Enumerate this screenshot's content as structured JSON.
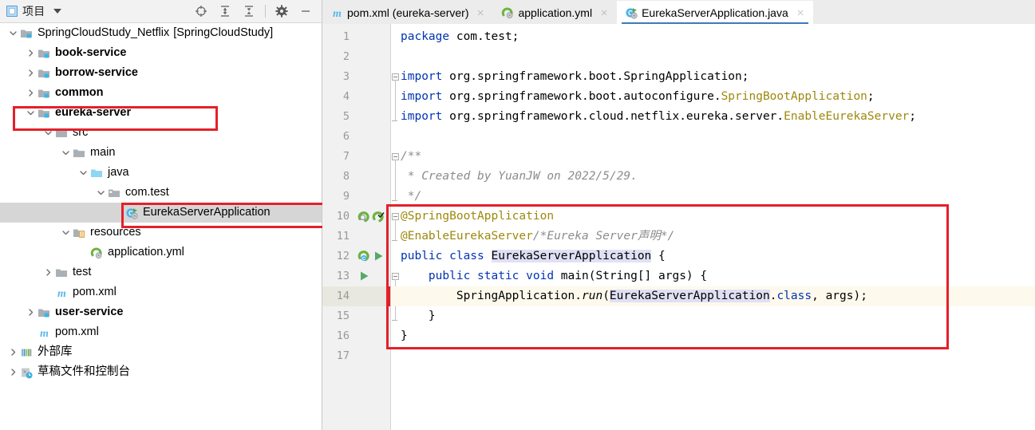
{
  "panel": {
    "title": "项目",
    "icons": [
      {
        "name": "locate-icon",
        "label": "定位"
      },
      {
        "name": "expand-all-icon",
        "label": "展开全部"
      },
      {
        "name": "collapse-all-icon",
        "label": "折叠全部"
      },
      {
        "name": "gear-icon",
        "label": "设置"
      },
      {
        "name": "minimize-icon",
        "label": "最小化"
      }
    ],
    "dropdown_label": "项目"
  },
  "tree": [
    {
      "id": "root",
      "label": "SpringCloudStudy_Netflix",
      "suffix": "[SpringCloudStudy]",
      "depth": 0,
      "arrow": "down",
      "icon": "module-folder",
      "bold": false,
      "bold_suffix": true,
      "selected": false,
      "boxed": false
    },
    {
      "id": "book-service",
      "label": "book-service",
      "depth": 1,
      "arrow": "right",
      "icon": "module-folder",
      "bold": true,
      "selected": false,
      "boxed": false
    },
    {
      "id": "borrow-service",
      "label": "borrow-service",
      "depth": 1,
      "arrow": "right",
      "icon": "module-folder",
      "bold": true,
      "selected": false,
      "boxed": false
    },
    {
      "id": "common",
      "label": "common",
      "depth": 1,
      "arrow": "right",
      "icon": "module-folder",
      "bold": true,
      "selected": false,
      "boxed": false
    },
    {
      "id": "eureka-server",
      "label": "eureka-server",
      "depth": 1,
      "arrow": "down",
      "icon": "module-folder",
      "bold": true,
      "selected": false,
      "boxed": true
    },
    {
      "id": "src",
      "label": "src",
      "depth": 2,
      "arrow": "down",
      "icon": "folder-gray",
      "bold": false,
      "selected": false,
      "boxed": false
    },
    {
      "id": "main",
      "label": "main",
      "depth": 3,
      "arrow": "down",
      "icon": "folder-gray",
      "bold": false,
      "selected": false,
      "boxed": false
    },
    {
      "id": "java",
      "label": "java",
      "depth": 4,
      "arrow": "down",
      "icon": "folder-blue",
      "bold": false,
      "selected": false,
      "boxed": false
    },
    {
      "id": "com-test",
      "label": "com.test",
      "depth": 5,
      "arrow": "down",
      "icon": "package-folder",
      "bold": false,
      "selected": false,
      "boxed": false
    },
    {
      "id": "EurekaServerApplication",
      "label": "EurekaServerApplication",
      "depth": 6,
      "arrow": "none",
      "icon": "java-class-run",
      "bold": false,
      "selected": true,
      "boxed": true
    },
    {
      "id": "resources",
      "label": "resources",
      "depth": 3,
      "arrow": "down",
      "icon": "folder-resources",
      "bold": false,
      "selected": false,
      "boxed": false
    },
    {
      "id": "application-yml",
      "label": "application.yml",
      "depth": 4,
      "arrow": "none",
      "icon": "yml-spring",
      "bold": false,
      "selected": false,
      "boxed": false
    },
    {
      "id": "test",
      "label": "test",
      "depth": 2,
      "arrow": "right",
      "icon": "folder-gray",
      "bold": false,
      "selected": false,
      "boxed": false
    },
    {
      "id": "pom-module",
      "label": "pom.xml",
      "depth": 2,
      "arrow": "none",
      "icon": "maven-m",
      "bold": false,
      "selected": false,
      "boxed": false
    },
    {
      "id": "user-service",
      "label": "user-service",
      "depth": 1,
      "arrow": "right",
      "icon": "module-folder",
      "bold": true,
      "selected": false,
      "boxed": false
    },
    {
      "id": "pom-root",
      "label": "pom.xml",
      "depth": 1,
      "arrow": "none",
      "icon": "maven-m",
      "bold": false,
      "selected": false,
      "boxed": false
    },
    {
      "id": "external-libraries",
      "label": "外部库",
      "depth": 0,
      "arrow": "right",
      "icon": "library",
      "bold": false,
      "selected": false,
      "boxed": false
    },
    {
      "id": "scratches",
      "label": "草稿文件和控制台",
      "depth": 0,
      "arrow": "right",
      "icon": "scratches",
      "bold": false,
      "selected": false,
      "boxed": false
    }
  ],
  "tabs": [
    {
      "id": "pom",
      "label": "pom.xml (eureka-server)",
      "icon": "maven-m",
      "active": false,
      "closable": true
    },
    {
      "id": "yml",
      "label": "application.yml",
      "icon": "yml-spring",
      "active": false,
      "closable": true
    },
    {
      "id": "java",
      "label": "EurekaServerApplication.java",
      "icon": "java-class-run",
      "active": true,
      "closable": true
    }
  ],
  "editor": {
    "active_file": "EurekaServerApplication.java",
    "caret_line": 14,
    "line_numbers": [
      1,
      2,
      3,
      4,
      5,
      6,
      7,
      8,
      9,
      10,
      11,
      12,
      13,
      14,
      15,
      16,
      17
    ],
    "lines": [
      {
        "n": 1,
        "segments": [
          {
            "t": "package ",
            "c": "kw"
          },
          {
            "t": "com.test;",
            "c": "pl"
          }
        ]
      },
      {
        "n": 2,
        "segments": []
      },
      {
        "n": 3,
        "segments": [
          {
            "t": "import ",
            "c": "kw"
          },
          {
            "t": "org.springframework.boot.SpringApplication;",
            "c": "pl"
          }
        ]
      },
      {
        "n": 4,
        "segments": [
          {
            "t": "import ",
            "c": "kw"
          },
          {
            "t": "org.springframework.boot.autoconfigure.",
            "c": "pl"
          },
          {
            "t": "SpringBootApplication",
            "c": "ann"
          },
          {
            "t": ";",
            "c": "pl"
          }
        ]
      },
      {
        "n": 5,
        "segments": [
          {
            "t": "import ",
            "c": "kw"
          },
          {
            "t": "org.springframework.cloud.netflix.eureka.server.",
            "c": "pl"
          },
          {
            "t": "EnableEurekaServer",
            "c": "ann"
          },
          {
            "t": ";",
            "c": "pl"
          }
        ]
      },
      {
        "n": 6,
        "segments": []
      },
      {
        "n": 7,
        "segments": [
          {
            "t": "/**",
            "c": "cmt"
          }
        ]
      },
      {
        "n": 8,
        "segments": [
          {
            "t": " * Created by YuanJW on 2022/5/29.",
            "c": "cmt"
          }
        ]
      },
      {
        "n": 9,
        "segments": [
          {
            "t": " */",
            "c": "cmt"
          }
        ]
      },
      {
        "n": 10,
        "segments": [
          {
            "t": "@SpringBootApplication",
            "c": "ann"
          }
        ]
      },
      {
        "n": 11,
        "segments": [
          {
            "t": "@EnableEurekaServer",
            "c": "ann"
          },
          {
            "t": "/*Eureka Server声明*/",
            "c": "cmt"
          }
        ]
      },
      {
        "n": 12,
        "segments": [
          {
            "t": "public ",
            "c": "kw"
          },
          {
            "t": "class ",
            "c": "kw"
          },
          {
            "t": "EurekaServerApplication",
            "c": "hl"
          },
          {
            "t": " {",
            "c": "pl"
          }
        ]
      },
      {
        "n": 13,
        "segments": [
          {
            "t": "    public ",
            "c": "kw"
          },
          {
            "t": "static ",
            "c": "kw"
          },
          {
            "t": "void ",
            "c": "kw"
          },
          {
            "t": "main",
            "c": "pl"
          },
          {
            "t": "(String[] args) {",
            "c": "pl"
          }
        ]
      },
      {
        "n": 14,
        "segments": [
          {
            "t": "        SpringApplication.",
            "c": "pl"
          },
          {
            "t": "run",
            "c": "mth"
          },
          {
            "t": "(",
            "c": "pl"
          },
          {
            "t": "EurekaServerApplication",
            "c": "hl"
          },
          {
            "t": ".",
            "c": "pl"
          },
          {
            "t": "class",
            "c": "kw"
          },
          {
            "t": ", args);",
            "c": "pl"
          }
        ]
      },
      {
        "n": 15,
        "segments": [
          {
            "t": "    }",
            "c": "pl"
          }
        ]
      },
      {
        "n": 16,
        "segments": [
          {
            "t": "}",
            "c": "pl"
          }
        ]
      },
      {
        "n": 17,
        "segments": []
      }
    ],
    "gutter_run_markers": [
      {
        "line": 10,
        "icon": "spring-bean-icon"
      },
      {
        "line": 10,
        "icon": "spring-bean-check-icon"
      },
      {
        "line": 12,
        "icon": "spring-boot-class-icon"
      },
      {
        "line": 12,
        "icon": "run-icon"
      },
      {
        "line": 13,
        "icon": "run-icon"
      }
    ]
  },
  "colors": {
    "annotation_box": "#e3202a",
    "keyword": "#0033b3",
    "annotation_text": "#9e880d",
    "comment": "#8c8c8c",
    "identifier_highlight": "#e0e0f5",
    "caret_line": "#fdf9ec",
    "selection": "#d6d6d6",
    "tab_underline": "#3d7ab8",
    "gutter_bg": "#f1f1f1"
  }
}
